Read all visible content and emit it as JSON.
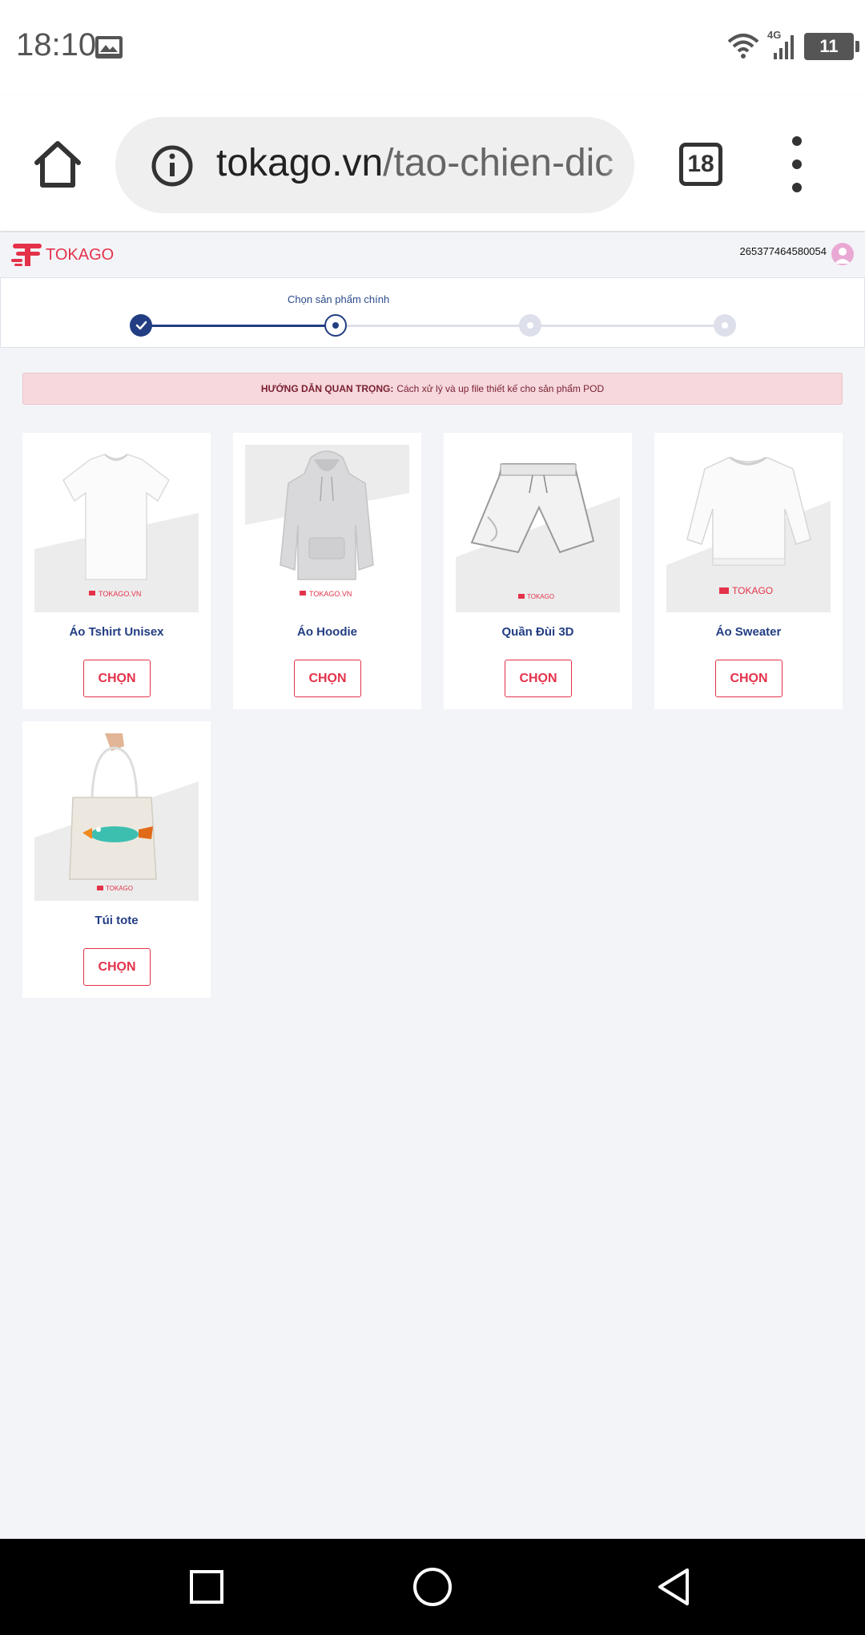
{
  "status_bar": {
    "time": "18:10",
    "network": "4G",
    "battery": "11"
  },
  "browser": {
    "url_domain": "tokago.vn",
    "url_path": "/tao-chien-dic",
    "tab_count": "18"
  },
  "site": {
    "logo_text": "TOKAGO",
    "user_id": "265377464580054"
  },
  "stepper": {
    "current_label": "Chọn sản phẩm chính",
    "accent_color": "#223d83"
  },
  "notice": {
    "strong": "HƯỚNG DẪN QUAN TRỌNG:",
    "text": "Cách xử lý và up file thiết kế cho sản phẩm POD"
  },
  "products": [
    {
      "name": "Áo Tshirt Unisex",
      "button": "CHỌN",
      "brand": "TOKAGO.VN"
    },
    {
      "name": "Áo Hoodie",
      "button": "CHỌN",
      "brand": "TOKAGO.VN"
    },
    {
      "name": "Quần Đùi 3D",
      "button": "CHỌN",
      "brand": "TOKAGO"
    },
    {
      "name": "Áo Sweater",
      "button": "CHỌN",
      "brand": "TOKAGO"
    },
    {
      "name": "Túi tote",
      "button": "CHỌN",
      "brand": "TOKAGO"
    }
  ]
}
